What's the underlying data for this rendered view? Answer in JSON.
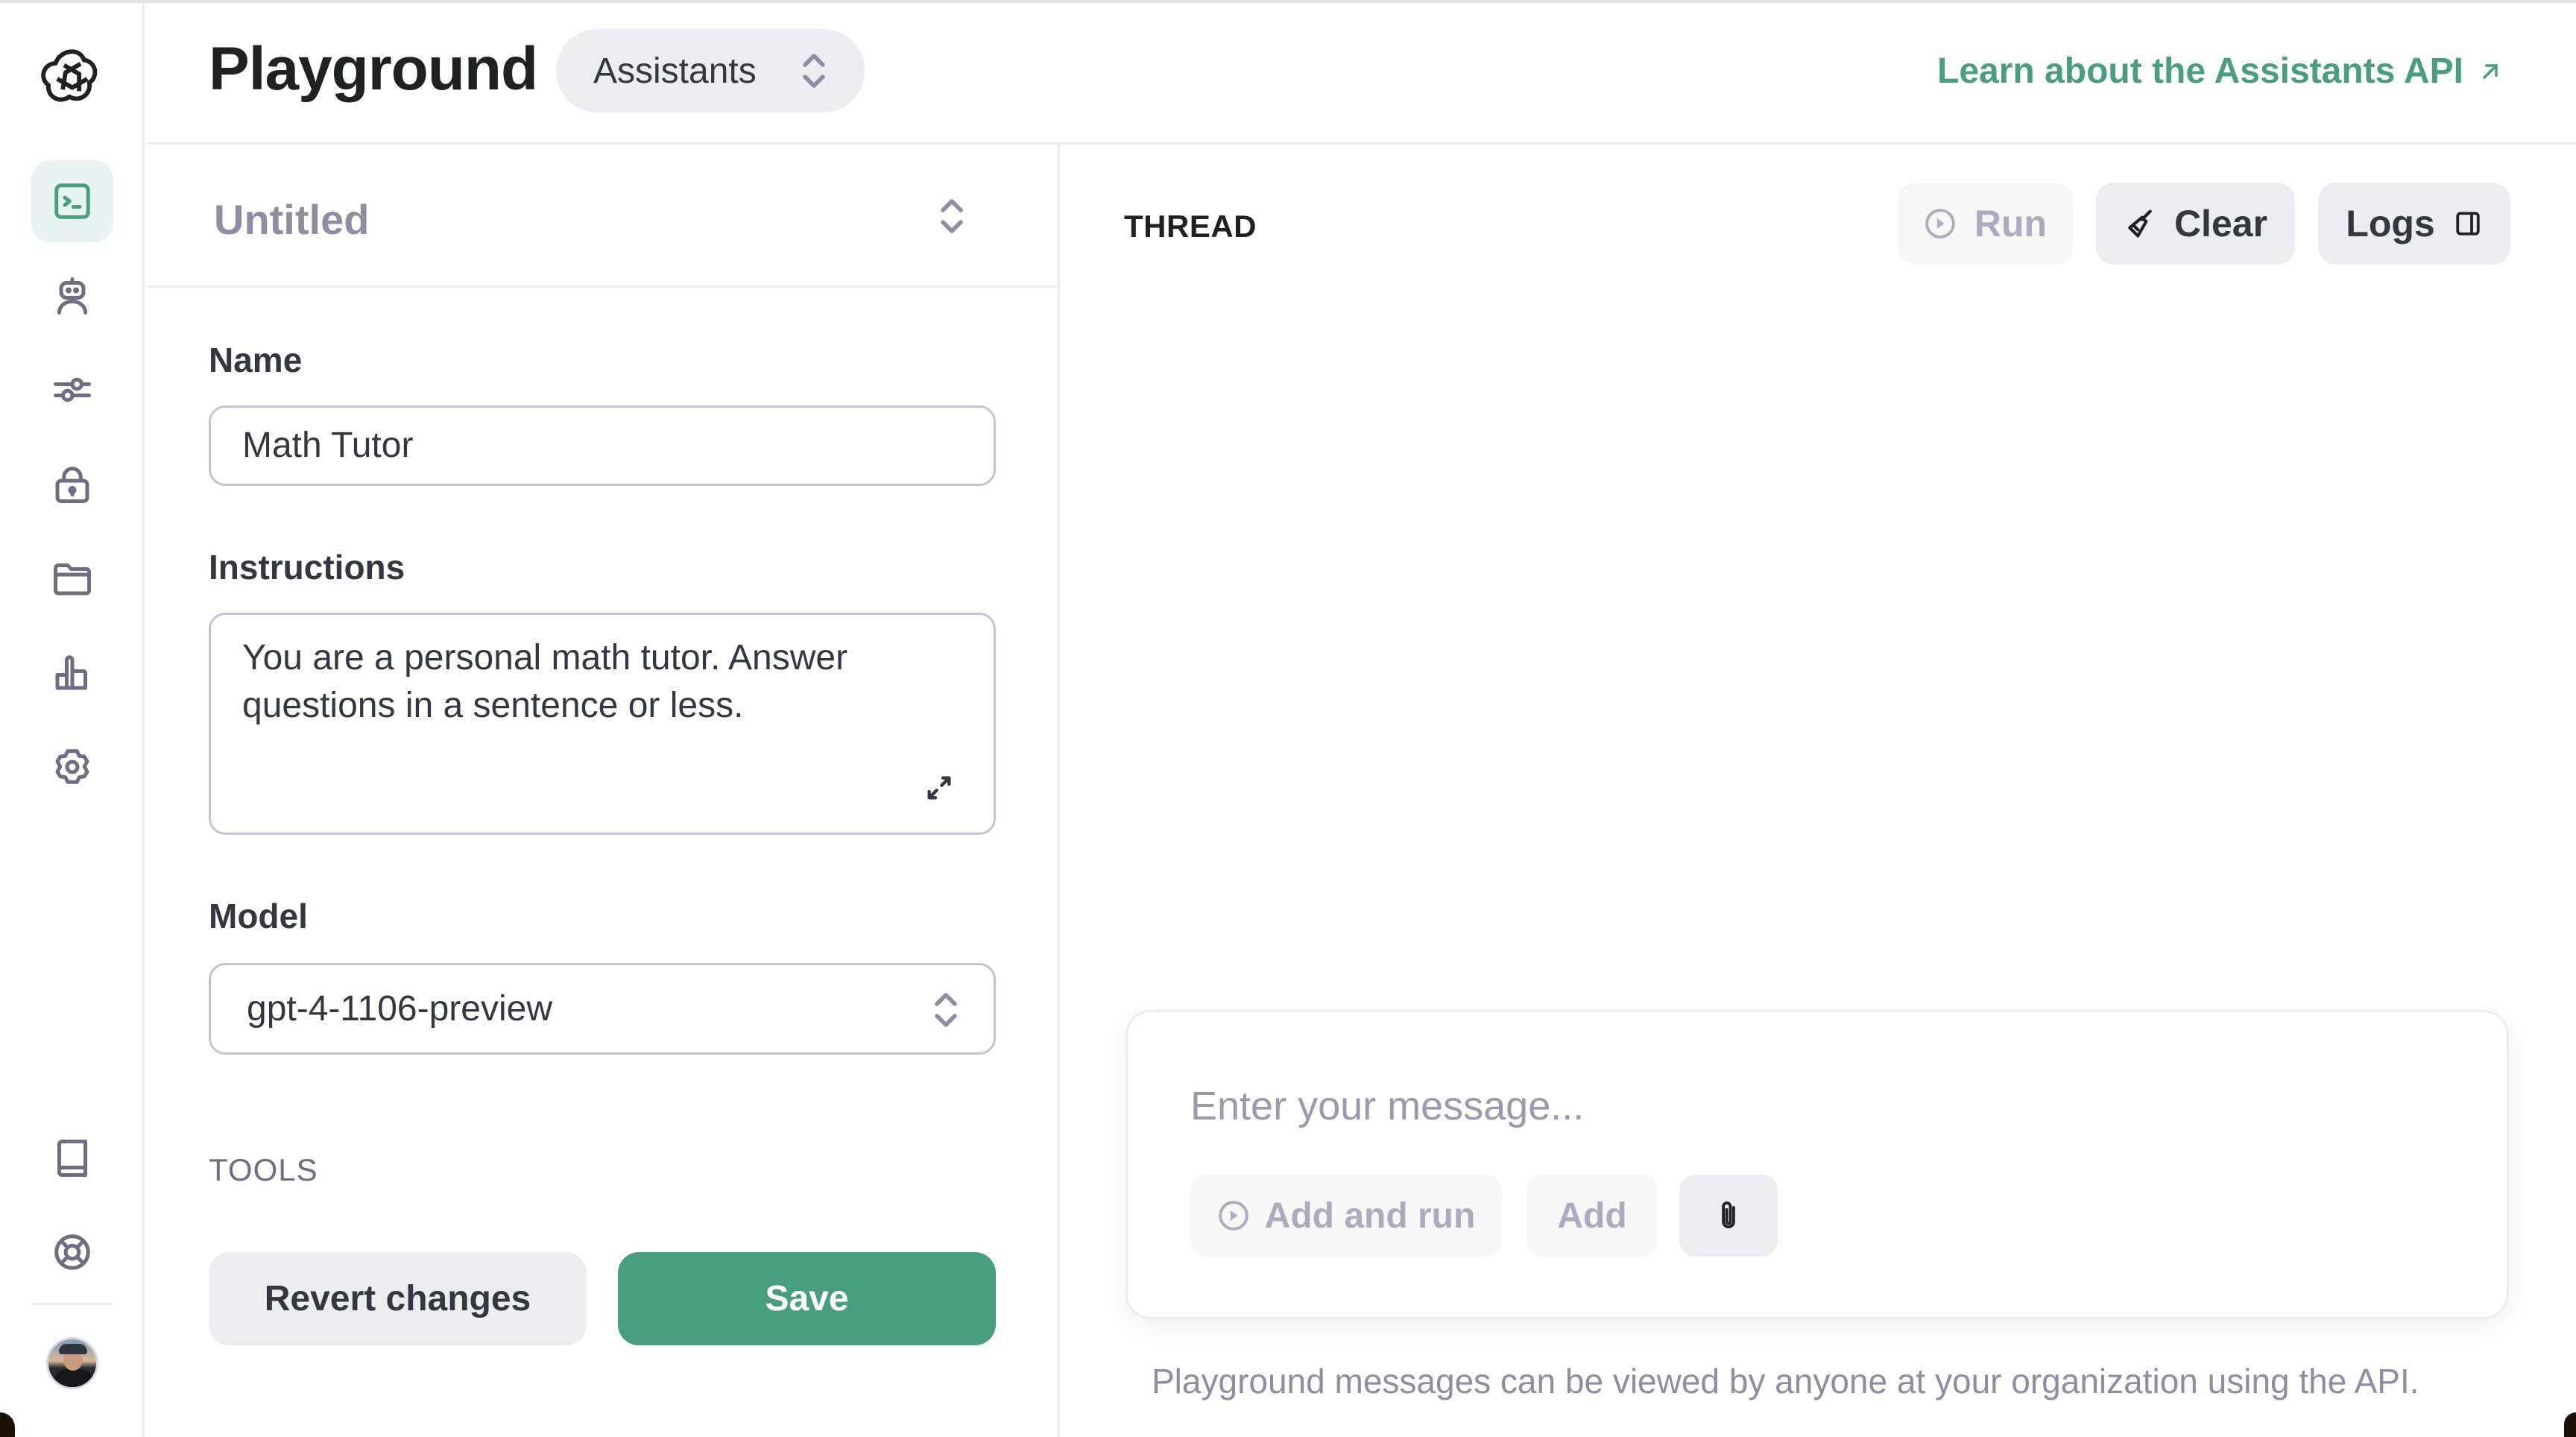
{
  "app": {
    "title": "Playground",
    "mode": "Assistants",
    "learn_link": "Learn about the Assistants API"
  },
  "sidebar": {
    "items": [
      {
        "name": "playground",
        "icon": "terminal-icon",
        "active": true
      },
      {
        "name": "assistants",
        "icon": "robot-icon",
        "active": false
      },
      {
        "name": "fine-tuning",
        "icon": "sliders-icon",
        "active": false
      },
      {
        "name": "api-keys",
        "icon": "lock-icon",
        "active": false
      },
      {
        "name": "files",
        "icon": "folder-icon",
        "active": false
      },
      {
        "name": "usage",
        "icon": "bar-chart-icon",
        "active": false
      },
      {
        "name": "settings",
        "icon": "gear-icon",
        "active": false
      }
    ],
    "bottom_items": [
      {
        "name": "documentation",
        "icon": "book-icon"
      },
      {
        "name": "help",
        "icon": "lifebuoy-icon"
      }
    ]
  },
  "assistant": {
    "selected": "Untitled",
    "name_label": "Name",
    "name_value": "Math Tutor",
    "instructions_label": "Instructions",
    "instructions_value": "You are a personal math tutor. Answer questions in a sentence or less.",
    "model_label": "Model",
    "model_value": "gpt-4-1106-preview",
    "tools_label": "TOOLS",
    "revert_label": "Revert changes",
    "save_label": "Save"
  },
  "thread": {
    "title": "THREAD",
    "run_label": "Run",
    "clear_label": "Clear",
    "logs_label": "Logs",
    "message_placeholder": "Enter your message...",
    "add_and_run_label": "Add and run",
    "add_label": "Add",
    "footer_note": "Playground messages can be viewed by anyone at your organization using the API."
  },
  "colors": {
    "accent": "#4a9e80",
    "active_bg": "#e8f4f1",
    "button_bg": "#ececf1",
    "muted_text": "#8e8ea0"
  }
}
